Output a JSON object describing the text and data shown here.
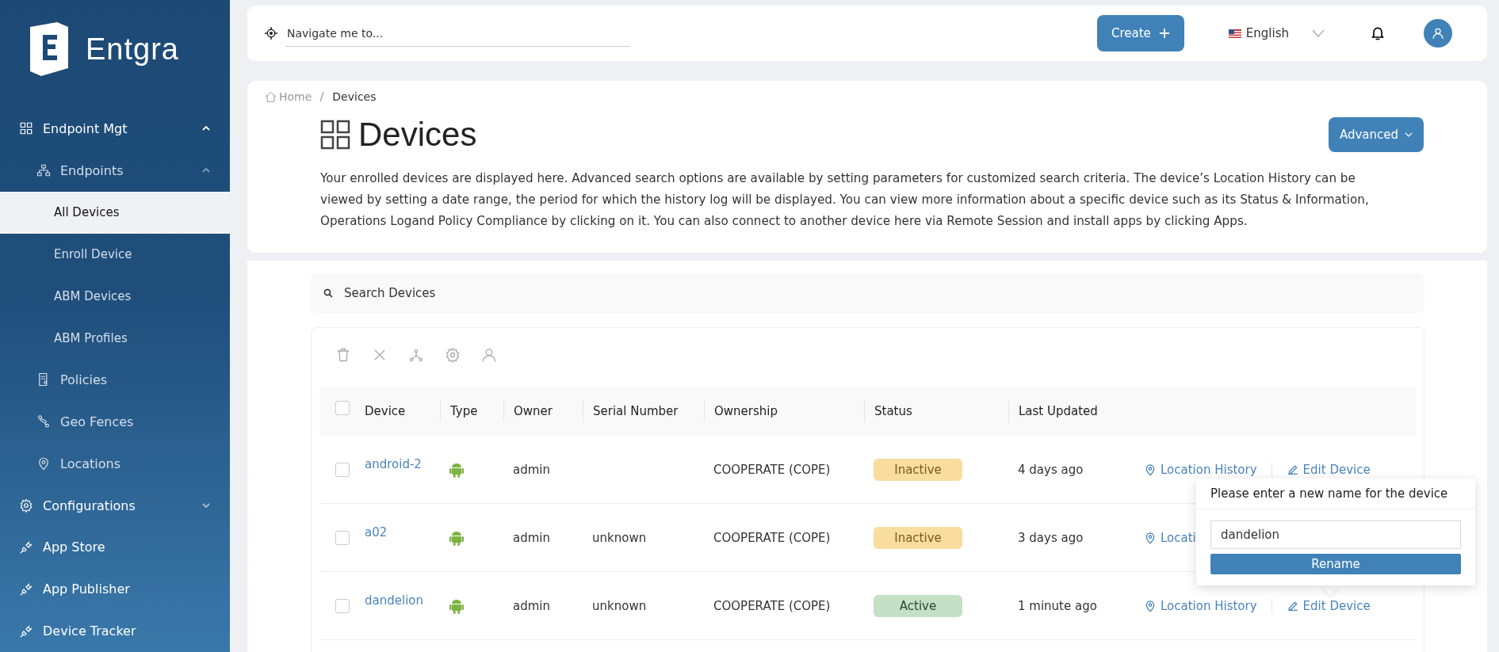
{
  "brand": {
    "name": "Entgra"
  },
  "sidebar": {
    "items": [
      {
        "label": "Endpoint Mgt",
        "expanded": true,
        "children": [
          {
            "label": "Endpoints",
            "expanded": true,
            "children": [
              {
                "label": "All Devices",
                "selected": true
              },
              {
                "label": "Enroll Device",
                "selected": false
              },
              {
                "label": "ABM Devices",
                "selected": false
              },
              {
                "label": "ABM Profiles",
                "selected": false
              }
            ]
          },
          {
            "label": "Policies"
          },
          {
            "label": "Geo Fences"
          },
          {
            "label": "Locations"
          }
        ]
      },
      {
        "label": "Configurations",
        "expanded": false
      },
      {
        "label": "App Store"
      },
      {
        "label": "App Publisher"
      },
      {
        "label": "Device Tracker"
      }
    ]
  },
  "header": {
    "search": {
      "placeholder": "Navigate me to..."
    },
    "create_button": "Create",
    "language": "English"
  },
  "breadcrumb": [
    "Home",
    "Devices"
  ],
  "page": {
    "title": "Devices",
    "advanced_button": "Advanced",
    "description": "Your enrolled devices are displayed here. Advanced search options are available by setting parameters for customized search criteria. The device’s Location History can be viewed by setting a date range, the period for which the history log will be displayed. You can view more information about a specific device such as its Status & Information, Operations Logand Policy Compliance by clicking on it. You can also connect to another device here via Remote Session and install apps by clicking Apps."
  },
  "device_search": {
    "placeholder": "Search Devices"
  },
  "table": {
    "all_checked": false,
    "columns": [
      "Device",
      "Type",
      "Owner",
      "Serial Number",
      "Ownership",
      "Status",
      "Last Updated"
    ],
    "rows": [
      {
        "checked": false,
        "device": "android-2",
        "owner": "admin",
        "serial": "",
        "ownership": "COOPERATE (COPE)",
        "status": {
          "label": "Inactive",
          "kind": "inactive"
        },
        "updated": "4 days ago",
        "actions": [
          {
            "kind": "location",
            "label": "Location History"
          },
          {
            "kind": "edit",
            "label": "Edit Device"
          }
        ]
      },
      {
        "checked": false,
        "device": "a02",
        "owner": "admin",
        "serial": "unknown",
        "ownership": "COOPERATE (COPE)",
        "status": {
          "label": "Inactive",
          "kind": "inactive"
        },
        "updated": "3 days ago",
        "actions": [
          {
            "kind": "location",
            "label": "Locati"
          }
        ]
      },
      {
        "checked": false,
        "device": "dandelion",
        "owner": "admin",
        "serial": "unknown",
        "ownership": "COOPERATE (COPE)",
        "status": {
          "label": "Active",
          "kind": "active"
        },
        "updated": "1 minute ago",
        "actions": [
          {
            "kind": "location",
            "label": "Location History"
          },
          {
            "kind": "edit",
            "label": "Edit Device"
          }
        ]
      }
    ]
  },
  "rename_popover": {
    "title": "Please enter a new name for the device",
    "value": "dandelion",
    "button": "Rename"
  }
}
